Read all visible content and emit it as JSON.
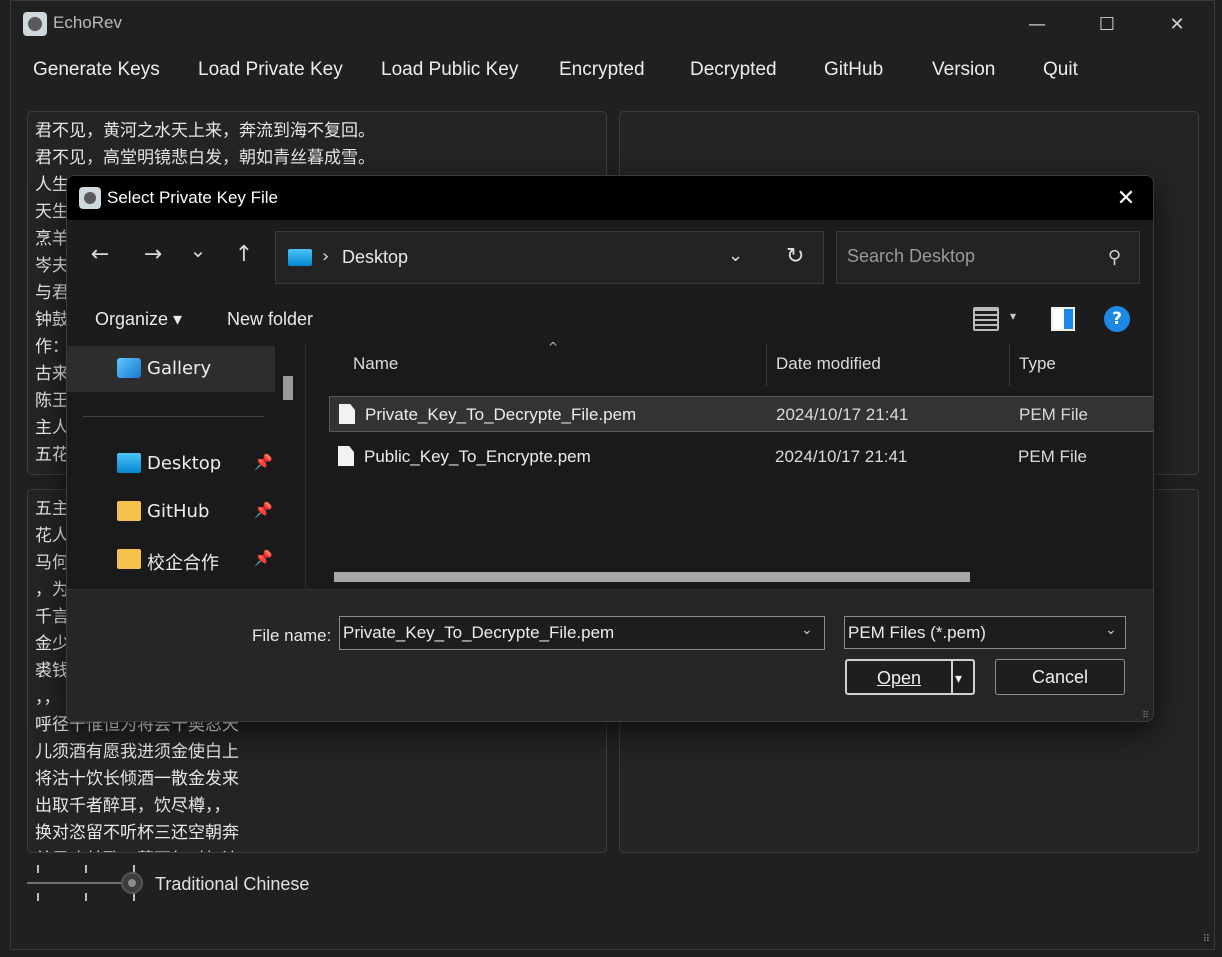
{
  "app": {
    "title": "EchoRev",
    "window_controls": {
      "minimize": "—",
      "maximize": "☐",
      "close": "✕"
    }
  },
  "menu": [
    "Generate Keys",
    "Load Private Key",
    "Load Public Key",
    "Encrypted",
    "Decrypted",
    "GitHub",
    "Version",
    "Quit"
  ],
  "panels": {
    "top_left_lines": [
      "君不见，黄河之水天上来，奔流到海不复回。",
      "君不见，高堂明镜悲白发，朝如青丝暮成雪。",
      "人生",
      "天生",
      "烹羊",
      "岑夫",
      "与君",
      "钟鼓",
      "作：",
      "古来",
      "陈王",
      "主人",
      "五花"
    ],
    "bottom_left_lines": [
      "五主",
      "花人",
      "马何",
      "，为",
      "千言",
      "金少",
      "裘钱",
      "，，",
      "呼径千惟恒为将尝十奥忍天",
      "儿须酒有愿我进须金使白上",
      "将沽十饮长倾酒一散金发来",
      "出取千者醉耳，饮尽樽，，",
      "换对恣留不听杯三还空朝奔",
      "美君欢其歌，莫百复对如流"
    ]
  },
  "slider": {
    "label": "Traditional Chinese",
    "position": 1.0
  },
  "dialog": {
    "title": "Select Private Key File",
    "close": "✕",
    "nav": {
      "back": "←",
      "forward": "→",
      "recent": "⌄",
      "up": "↑"
    },
    "address": {
      "separator": "›",
      "location": "Desktop",
      "chevron": "⌄",
      "refresh": "↻"
    },
    "search_placeholder": "Search Desktop",
    "toolbar": {
      "organize": "Organize ▾",
      "new_folder": "New folder",
      "view_chevron": "▾",
      "help": "?"
    },
    "nav_pane": [
      {
        "label": "Gallery",
        "icon": "gallery-icon",
        "pinned": false,
        "selected": true
      },
      {
        "label": "Desktop",
        "icon": "desktop-folder-icon",
        "pinned": true,
        "selected": false
      },
      {
        "label": "GitHub",
        "icon": "folder-icon",
        "pinned": true,
        "selected": false
      },
      {
        "label": "校企合作",
        "icon": "folder-icon",
        "pinned": true,
        "selected": false
      }
    ],
    "pin_glyph": "📌",
    "columns": {
      "name": "Name",
      "date": "Date modified",
      "type": "Type",
      "sort_glyph": "^"
    },
    "files": [
      {
        "name": "Private_Key_To_Decrypte_File.pem",
        "date": "2024/10/17 21:41",
        "type": "PEM File",
        "selected": true
      },
      {
        "name": "Public_Key_To_Encrypte.pem",
        "date": "2024/10/17 21:41",
        "type": "PEM File",
        "selected": false
      }
    ],
    "file_name_label": "File name:",
    "file_name_value": "Private_Key_To_Decrypte_File.pem",
    "file_type_value": "PEM Files (*.pem)",
    "dropdown_glyph": "⌄",
    "open_label": "Open",
    "open_arrow": "▾",
    "cancel_label": "Cancel",
    "colors": {
      "accent": "#1e88e5",
      "folder": "#f5c04e"
    }
  }
}
